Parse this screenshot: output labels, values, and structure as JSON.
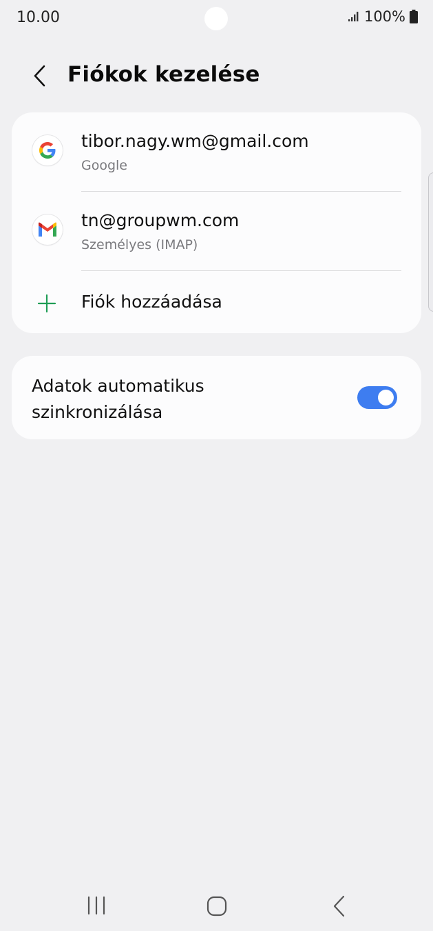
{
  "status_bar": {
    "time": "10.00",
    "battery": "100%",
    "signal_icon": "signal-icon",
    "battery_icon": "battery-icon"
  },
  "header": {
    "title": "Fiókok kezelése",
    "back_icon": "back-icon"
  },
  "accounts": [
    {
      "email": "tibor.nagy.wm@gmail.com",
      "type": "Google",
      "icon": "google-icon"
    },
    {
      "email": "tn@groupwm.com",
      "type": "Személyes (IMAP)",
      "icon": "gmail-icon"
    }
  ],
  "add_account": {
    "label": "Fiók hozzáadása",
    "icon": "plus-icon",
    "icon_color": "#1f9d55"
  },
  "sync": {
    "label": "Adatok automatikus szinkronizálása",
    "enabled": true,
    "toggle_color": "#3e7df0"
  },
  "nav_bar": {
    "recents_icon": "recents-icon",
    "home_icon": "home-icon",
    "back_icon": "nav-back-icon"
  }
}
